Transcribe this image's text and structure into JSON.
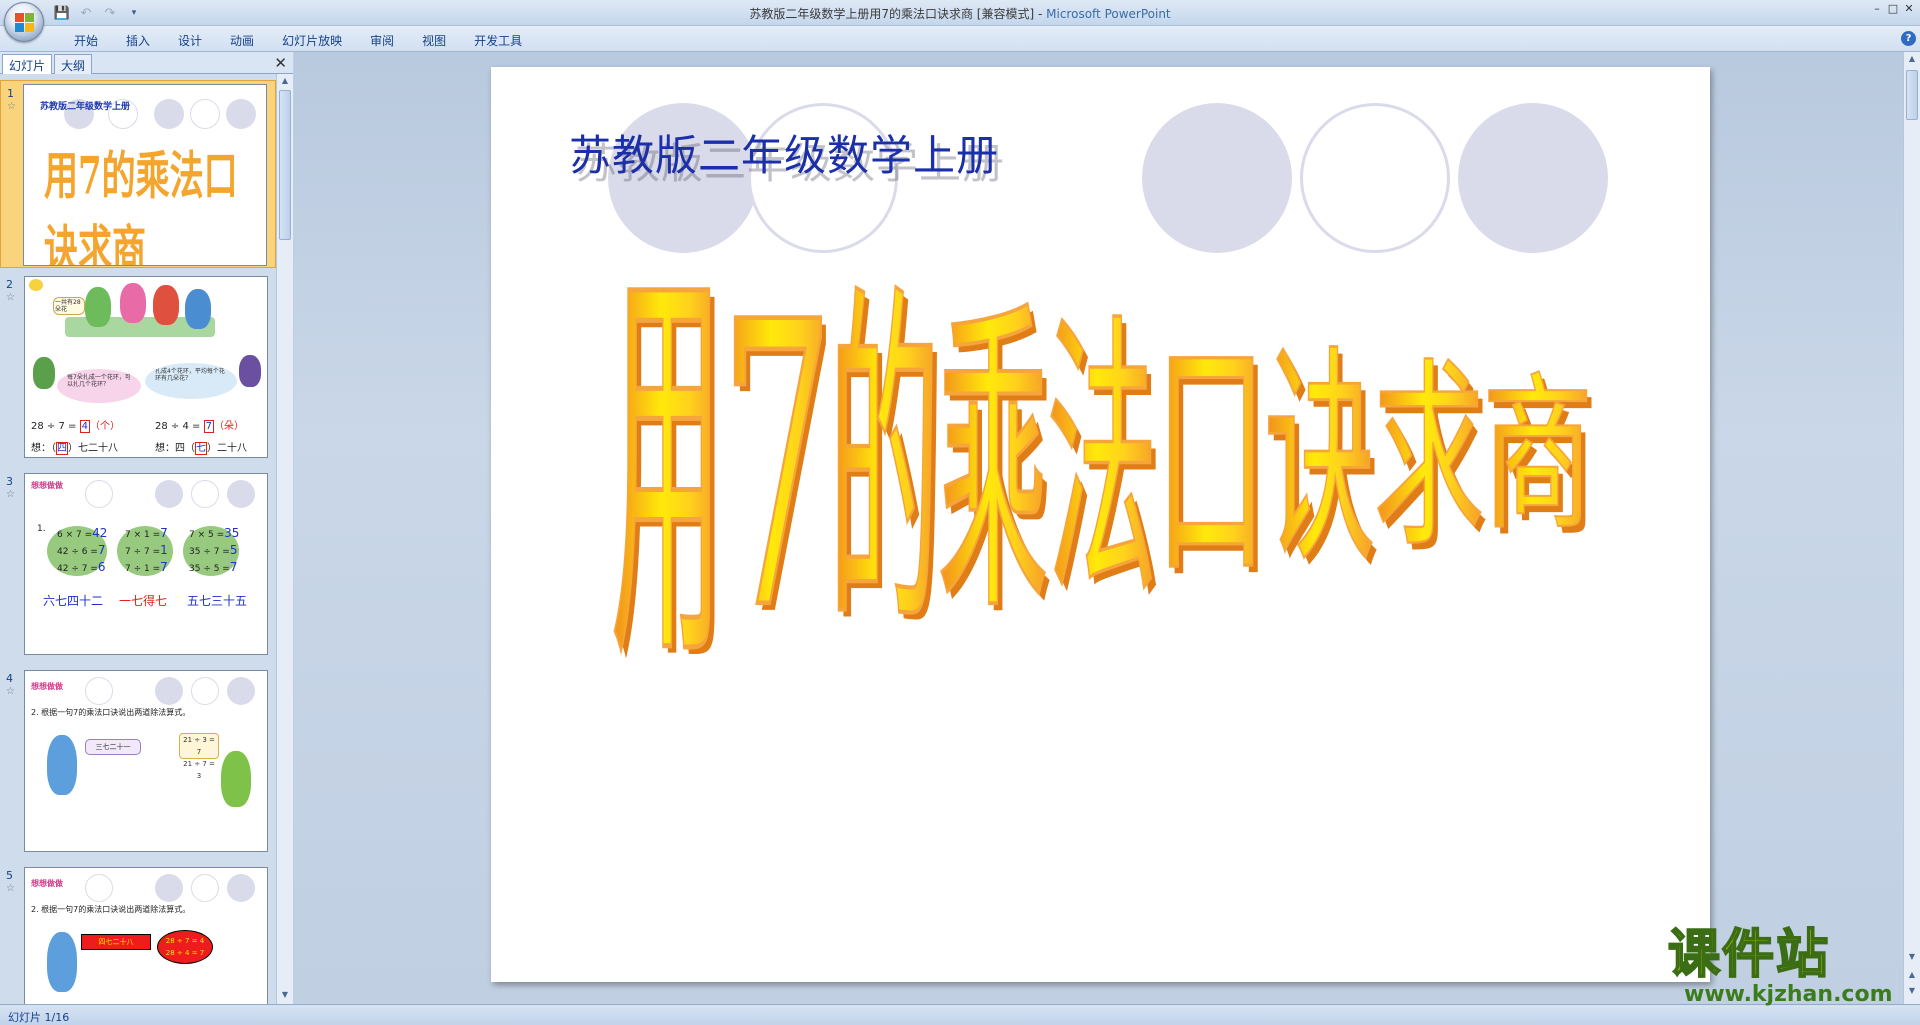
{
  "window": {
    "title": "苏教版二年级数学上册用7的乘法口诀求商 [兼容模式]",
    "title_sep": " - ",
    "app_name": "Microsoft PowerPoint"
  },
  "ribbon": {
    "tabs": [
      "开始",
      "插入",
      "设计",
      "动画",
      "幻灯片放映",
      "审阅",
      "视图",
      "开发工具"
    ]
  },
  "pane": {
    "tabs": [
      "幻灯片",
      "大纲"
    ]
  },
  "thumbnails": {
    "slide1": {
      "number": "1",
      "small_title": "苏教版二年级数学上册",
      "art": "用7的乘法口诀求商"
    },
    "slide2": {
      "number": "2",
      "bubble_top": "一共有28朵花",
      "bubble_left": "每7朵扎成一个花环，可以扎几个花环？",
      "bubble_right": "扎成4个花环，平均每个花环有几朵花？",
      "eq_left": "28 ÷ 7 =",
      "eq_left_ans": "4",
      "eq_left_unit": "（个）",
      "eq_right": "28 ÷ 4 =",
      "eq_right_ans": "7",
      "eq_right_unit": "（朵）",
      "think_left": "想：（",
      "think_left_ans": "四",
      "think_left_rest": "）七二十八",
      "think_right": "想：四（",
      "think_right_ans": "七",
      "think_right_rest": "）二十八"
    },
    "slide3": {
      "number": "3",
      "label": "想想做做",
      "item": "1.",
      "blob1": [
        "6 × 7 =",
        "42",
        "42 ÷ 6 =",
        "7",
        "42 ÷ 7 =",
        "6"
      ],
      "blob2": [
        "7 × 1 =",
        "7",
        "7 ÷ 7 =",
        "1",
        "7 ÷ 1 =",
        "7"
      ],
      "blob3": [
        "7 × 5 =",
        "35",
        "35 ÷ 7 =",
        "5",
        "35 ÷ 5 =",
        "7"
      ],
      "rhyme1": "六七四十二",
      "rhyme2": "一七得七",
      "rhyme3": "五七三十五"
    },
    "slide4": {
      "number": "4",
      "label": "想想做做",
      "task": "2. 根据一句7的乘法口诀说出两道除法算式。",
      "bubble_left": "三七二十一",
      "bubble_right1": "21 ÷ 3 = 7",
      "bubble_right2": "21 ÷ 7 = 3"
    },
    "slide5": {
      "number": "5",
      "label": "想想做做",
      "task": "2. 根据一句7的乘法口诀说出两道除法算式。",
      "bubble_left": "四七二十八",
      "bubble_right1": "28 ÷ 7 = 4",
      "bubble_right2": "28 ÷ 4 = 7"
    }
  },
  "slide": {
    "subtitle": "苏教版二年级数学上册",
    "wordart": "用7的乘法口诀求商"
  },
  "status": {
    "text": "幻灯片 1/16"
  },
  "watermark": {
    "logo": "课件站",
    "url": "www.kjzhan.com"
  },
  "colors": {
    "wordart_orange": "#f39a2a",
    "wordart_yellow": "#ffe600",
    "subtitle_blue": "#1b2fa8",
    "circle_gray": "#dadbea"
  }
}
